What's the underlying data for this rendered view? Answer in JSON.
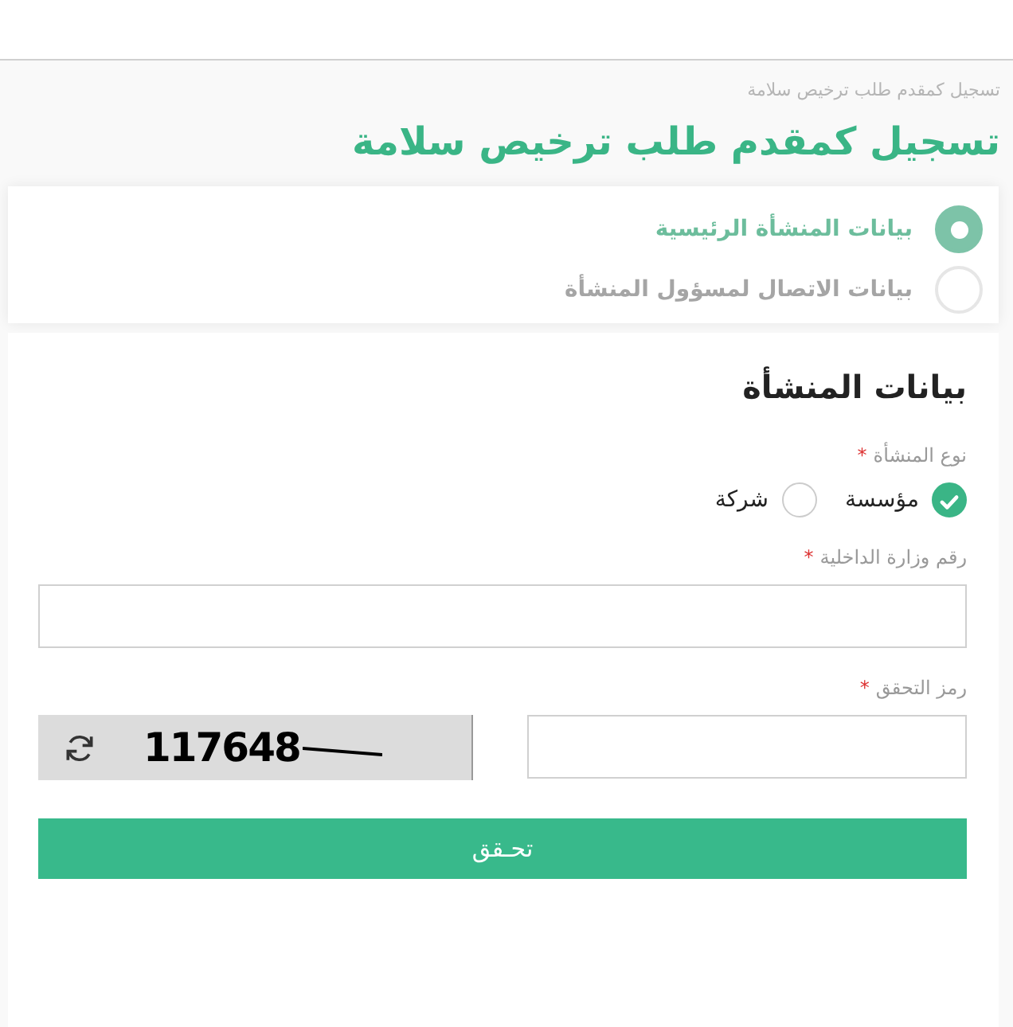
{
  "breadcrumb": "تسجيل كمقدم طلب ترخيص سلامة",
  "title": "تسجيل كمقدم طلب ترخيص سلامة",
  "steps": [
    {
      "label": "بيانات المنشأة الرئيسية",
      "selected": true
    },
    {
      "label": "بيانات الاتصال لمسؤول المنشأة",
      "selected": false
    }
  ],
  "section_title": "بيانات المنشأة",
  "facility_type": {
    "label": "نوع المنشأة",
    "required_mark": "*",
    "options": [
      {
        "label": "مؤسسة",
        "selected": true
      },
      {
        "label": "شركة",
        "selected": false
      }
    ]
  },
  "moi_number": {
    "label": "رقم وزارة الداخلية",
    "required_mark": "*"
  },
  "captcha": {
    "label": "رمز التحقق",
    "required_mark": "*",
    "code": "117648"
  },
  "verify_button": "تحـقق"
}
